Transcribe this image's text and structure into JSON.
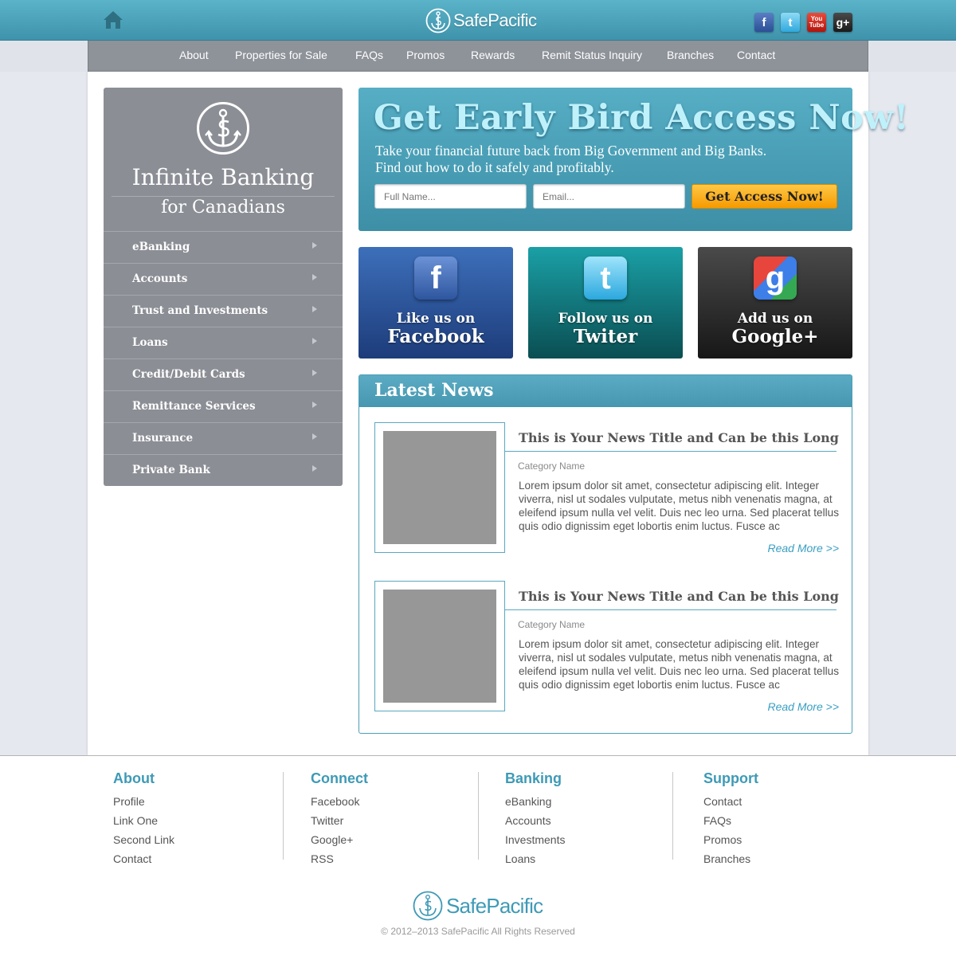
{
  "header": {
    "brand": "SafePacific",
    "home_icon": "home-icon",
    "social": [
      {
        "name": "facebook-icon",
        "glyph": "f"
      },
      {
        "name": "twitter-icon",
        "glyph": "t"
      },
      {
        "name": "youtube-icon",
        "glyph": "You Tube"
      },
      {
        "name": "google-plus-icon",
        "glyph": "g+"
      }
    ]
  },
  "nav": {
    "items": [
      "About",
      "Properties for Sale",
      "FAQs",
      "Promos",
      "Rewards",
      "Remit Status Inquiry",
      "Branches",
      "Contact"
    ]
  },
  "sidebar": {
    "title": "Infinite Banking",
    "subtitle": "for Canadians",
    "items": [
      "eBanking",
      "Accounts",
      "Trust and Investments",
      "Loans",
      "Credit/Debit Cards",
      "Remittance Services",
      "Insurance",
      "Private Bank"
    ]
  },
  "hero": {
    "title": "Get Early Bird Access Now!",
    "line1": "Take your financial future back from Big Government and Big Banks.",
    "line2": "Find out how to do it safely and profitably.",
    "name_placeholder": "Full Name...",
    "email_placeholder": "Email...",
    "button": "Get Access Now!"
  },
  "tiles": [
    {
      "line1": "Like us on",
      "line2": "Facebook",
      "glyph": "f"
    },
    {
      "line1": "Follow us on",
      "line2": "Twiter",
      "glyph": "t"
    },
    {
      "line1": "Add us on",
      "line2": "Google+",
      "glyph": "g"
    }
  ],
  "news": {
    "heading": "Latest News",
    "articles": [
      {
        "title": "This is Your News Title and Can be this Long",
        "category": "Category Name",
        "body": "Lorem ipsum dolor sit amet, consectetur adipiscing elit. Integer viverra, nisl ut sodales vulputate, metus nibh venenatis magna, at eleifend ipsum nulla vel velit. Duis nec leo urna. Sed placerat tellus quis odio dignissim eget lobortis enim luctus. Fusce ac",
        "more": "Read More >>"
      },
      {
        "title": "This is Your News Title and Can be this Long",
        "category": "Category Name",
        "body": "Lorem ipsum dolor sit amet, consectetur adipiscing elit. Integer viverra, nisl ut sodales vulputate, metus nibh venenatis magna, at eleifend ipsum nulla vel velit. Duis nec leo urna. Sed placerat tellus quis odio dignissim eget lobortis enim luctus. Fusce ac",
        "more": "Read More >>"
      }
    ]
  },
  "footer": {
    "columns": [
      {
        "heading": "About",
        "links": [
          "Profile",
          "Link One",
          "Second Link",
          "Contact"
        ]
      },
      {
        "heading": "Connect",
        "links": [
          "Facebook",
          "Twitter",
          "Google+",
          "RSS"
        ]
      },
      {
        "heading": "Banking",
        "links": [
          "eBanking",
          "Accounts",
          "Investments",
          "Loans"
        ]
      },
      {
        "heading": "Support",
        "links": [
          "Contact",
          "FAQs",
          "Promos",
          "Branches"
        ]
      }
    ],
    "brand": "SafePacific",
    "copyright": "© 2012–2013 SafePacific   All Rights Reserved"
  },
  "colors": {
    "accent": "#3e9ab6",
    "header": "#4aa3ba",
    "nav": "#8e9299",
    "sidebar": "#8b8e95",
    "button": "#f7a500"
  }
}
